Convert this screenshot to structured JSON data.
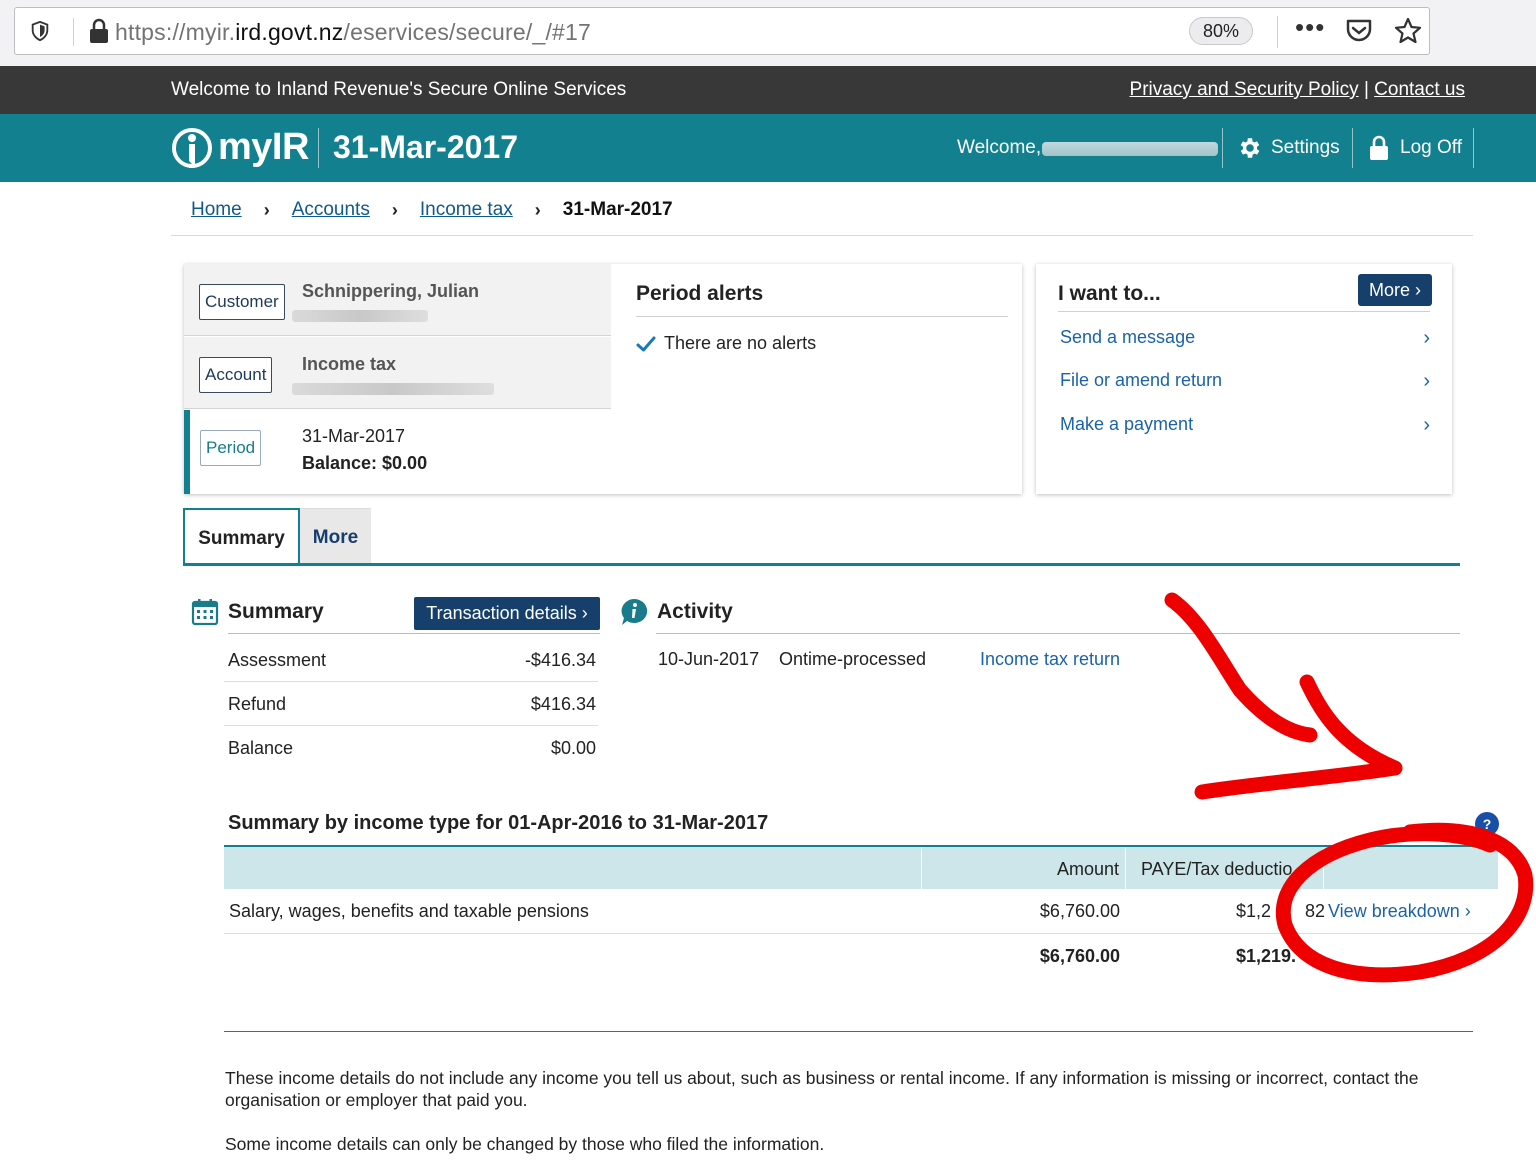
{
  "browser": {
    "url_prefix": "https://myir.",
    "url_domain": "ird.govt.nz",
    "url_suffix": "/eservices/secure/_/#17",
    "zoom": "80%",
    "dots": "•••"
  },
  "topbar": {
    "welcome": "Welcome to Inland Revenue's Secure Online Services",
    "privacy_link": "Privacy and Security Policy",
    "separator": "|",
    "contact_link": "Contact us"
  },
  "header": {
    "logo_text": "myIR",
    "period": "31-Mar-2017",
    "welcome": "Welcome,",
    "settings": "Settings",
    "logoff": "Log Off"
  },
  "breadcrumb": {
    "items": [
      "Home",
      "Accounts",
      "Income tax"
    ],
    "current": "31-Mar-2017"
  },
  "info": {
    "customer_tag": "Customer",
    "customer_name": "Schnippering, Julian",
    "account_tag": "Account",
    "account_name": "Income tax",
    "period_tag": "Period",
    "period_value": "31-Mar-2017",
    "balance": "Balance: $0.00"
  },
  "alerts": {
    "title": "Period alerts",
    "message": "There are no alerts"
  },
  "want": {
    "title": "I want to...",
    "more_btn": "More ›",
    "items": [
      "Send a message",
      "File or amend return",
      "Make a payment"
    ]
  },
  "tabs": [
    "Summary",
    "More"
  ],
  "summary": {
    "title": "Summary",
    "transaction_btn": "Transaction details ›",
    "rows": [
      {
        "label": "Assessment",
        "value": "-$416.34"
      },
      {
        "label": "Refund",
        "value": "$416.34"
      },
      {
        "label": "Balance",
        "value": "$0.00"
      }
    ]
  },
  "activity": {
    "title": "Activity",
    "date": "10-Jun-2017",
    "status": "Ontime-processed",
    "link": "Income tax return"
  },
  "income": {
    "title": "Summary by income type for 01-Apr-2016 to 31-Mar-2017",
    "help": "?",
    "col_amount": "Amount",
    "col_paye": "PAYE/Tax deductio",
    "row_label": "Salary, wages, benefits and taxable pensions",
    "row_amount": "$6,760.00",
    "row_paye": "$1,2",
    "row_paye_tail": "82",
    "view_breakdown": "View breakdown ›",
    "total_amount": "$6,760.00",
    "total_paye": "$1,219."
  },
  "notes": {
    "line1": "These income details do not include any income you tell us about, such as business or rental income. If any information is missing or incorrect, contact the organisation or employer that paid you.",
    "line2": "Some income details can only be changed by those who filed the information."
  },
  "colors": {
    "teal": "#13808f",
    "navy": "#173f6b",
    "link": "#1a63a8",
    "annotation": "#ee0000"
  }
}
